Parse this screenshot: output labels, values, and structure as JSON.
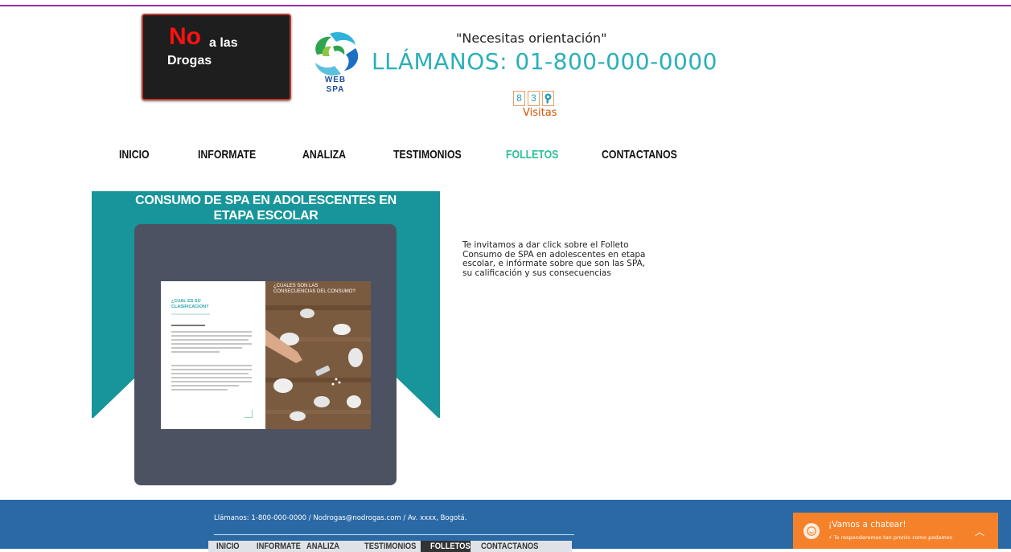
{
  "header": {
    "logo": {
      "no": "No",
      "a_las": "a las",
      "drogas": "Drogas"
    },
    "spa_logo": {
      "line1": "WEB",
      "line2": "SPA"
    },
    "tagline": "\"Necesitas orientación\"",
    "phone": "LLÁMANOS: 01-800-000-0000",
    "counter": {
      "digits": [
        "8",
        "3"
      ],
      "icon": "visitor-counter-icon",
      "label": "Visitas"
    }
  },
  "nav": {
    "items": [
      {
        "label": "INICIO"
      },
      {
        "label": "INFORMATE"
      },
      {
        "label": "ANALIZA"
      },
      {
        "label": "TESTIMONIOS"
      },
      {
        "label": "FOLLETOS",
        "active": true
      },
      {
        "label": "CONTACTANOS"
      }
    ]
  },
  "banner": {
    "title_line1": "CONSUMO DE SPA EN ADOLESCENTES EN",
    "title_line2": "ETAPA ESCOLAR",
    "brochure_left_title_line1": "¿CUAL ES SU",
    "brochure_left_title_line2": "CLASIFICACION?",
    "brochure_right_caption_line1": "¿CUALES SON LAS",
    "brochure_right_caption_line2": "CONSECUENCIAS DEL CONSUMO?"
  },
  "promo_text": "Te invitamos a dar click sobre el Folleto Consumo de SPA en adolescentes en etapa escolar, e infórmate sobre que son las SPA, su calificación y sus consecuencias",
  "footer": {
    "contact": "Llámanos: 1-800-000-0000  /  Nodrogas@nodrogas.com  / Av. xxxx, Bogotá.",
    "nav": [
      {
        "label": "INICIO"
      },
      {
        "label": "INFORMATE"
      },
      {
        "label": "ANALIZA"
      },
      {
        "label": "TESTIMONIOS"
      },
      {
        "label": "FOLLETOS",
        "active": true
      },
      {
        "label": "CONTACTANOS"
      }
    ]
  },
  "chat": {
    "title": "¡Vamos a chatear!",
    "subtitle": "Te responderemos tan pronto como podamos",
    "icon": "chevron-up-icon"
  },
  "colors": {
    "accent_teal": "#17959a",
    "nav_active": "#2bbf9a",
    "footer_blue": "#2b69a5",
    "chat_orange": "#f5822a"
  }
}
